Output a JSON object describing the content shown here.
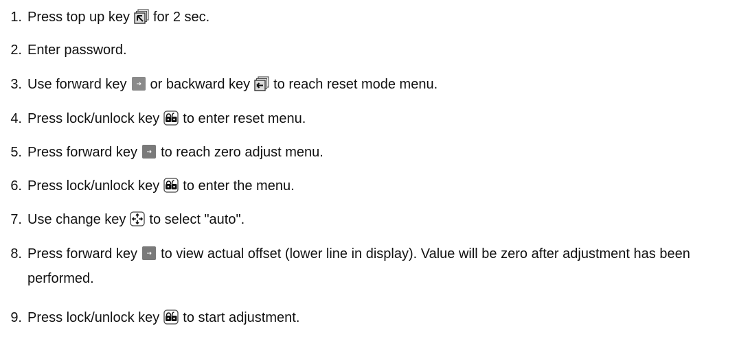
{
  "steps": [
    {
      "num": "1.",
      "pre": "Press top up key",
      "icon": "top-up-key-icon",
      "post": "for 2 sec."
    },
    {
      "num": "2.",
      "pre": "Enter password.",
      "icon": "",
      "post": ""
    },
    {
      "num": "3.",
      "pre": "Use forward key",
      "icon": "forward-key-icon",
      "mid": "or backward key",
      "icon2": "backward-key-icon",
      "post": "to reach reset mode menu."
    },
    {
      "num": "4.",
      "pre": "Press lock/unlock key",
      "icon": "lock-unlock-key-icon",
      "post": "to enter reset menu."
    },
    {
      "num": "5.",
      "pre": "Press forward key",
      "icon": "forward-key-icon",
      "post": "to reach zero adjust menu."
    },
    {
      "num": "6.",
      "pre": "Press lock/unlock key",
      "icon": "lock-unlock-key-icon",
      "post": "to enter the menu."
    },
    {
      "num": "7.",
      "pre": "Use change key",
      "icon": "change-key-icon",
      "post": "to select \"auto\"."
    },
    {
      "num": "8.",
      "pre": "Press forward key",
      "icon": "forward-key-icon",
      "post": "to view actual offset (lower line in display). Value will be zero after adjustment has been performed."
    },
    {
      "num": "9.",
      "pre": "Press lock/unlock key",
      "icon": "lock-unlock-key-icon",
      "post": "to start adjustment."
    }
  ],
  "colors": {
    "text": "#111111",
    "key_dark": "#777777",
    "key_light": "#eeeeee"
  }
}
